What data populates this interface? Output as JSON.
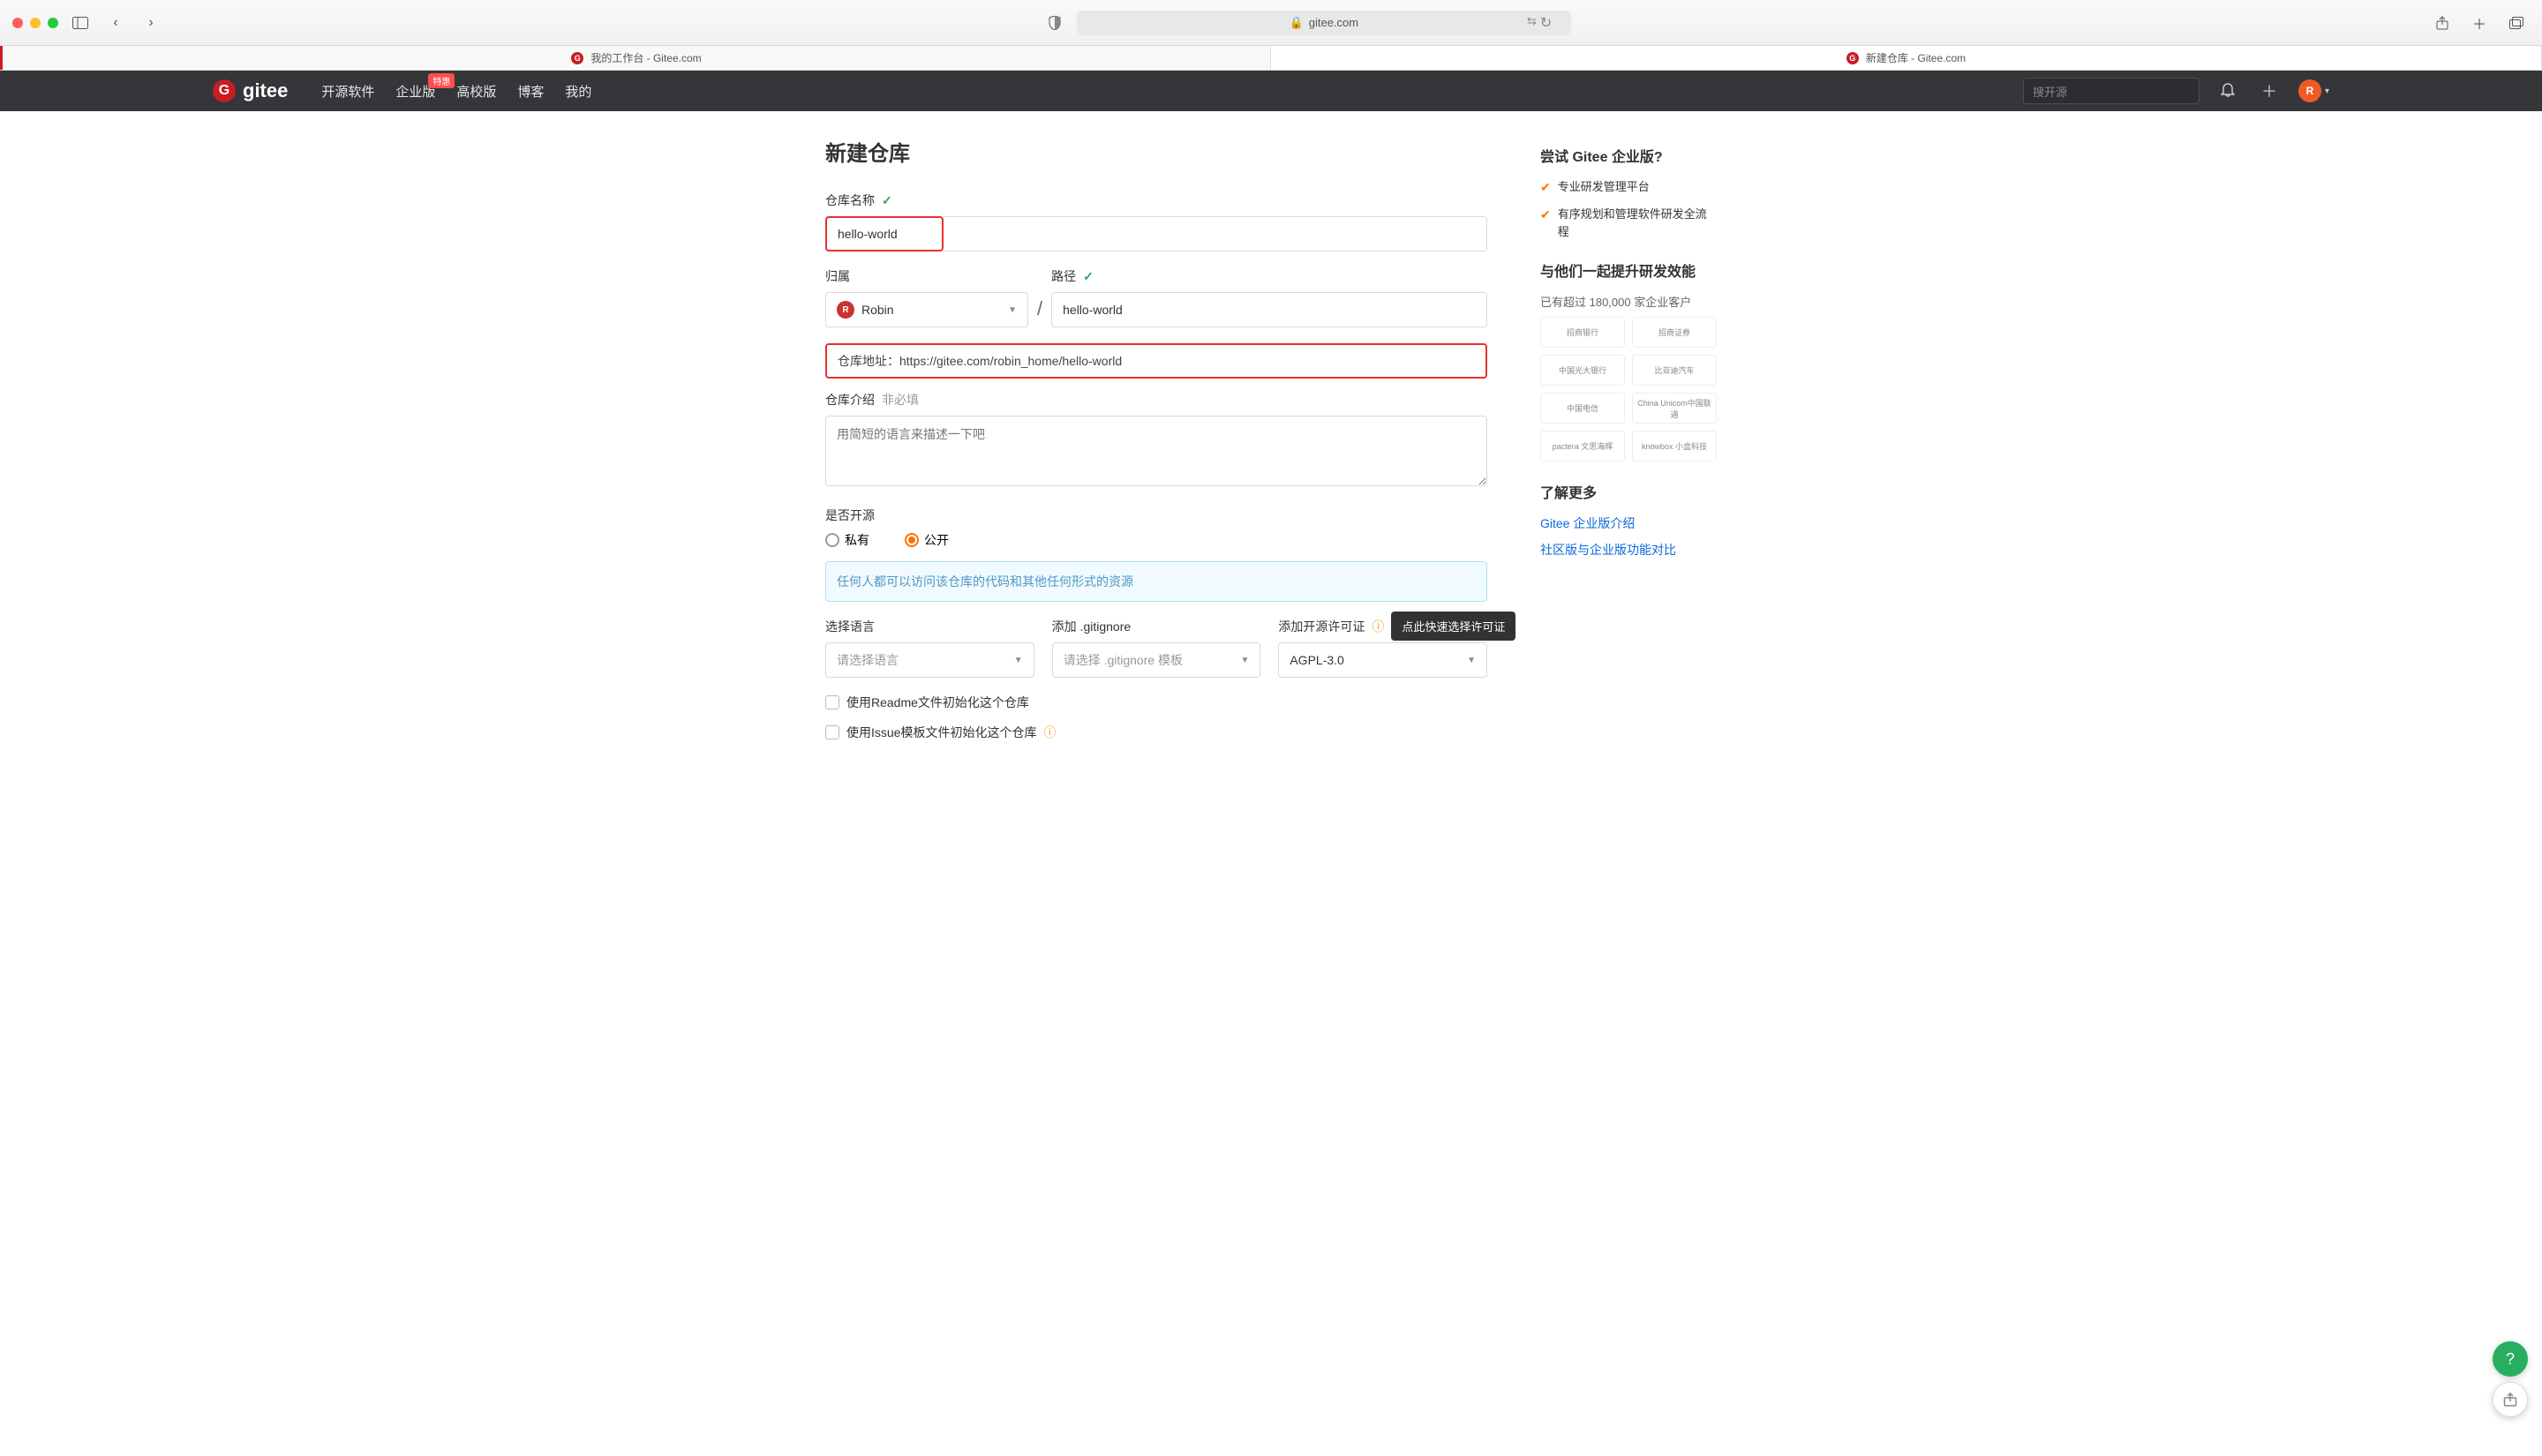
{
  "browser": {
    "url_host": "gitee.com",
    "tabs": [
      {
        "title": "我的工作台 - Gitee.com"
      },
      {
        "title": "新建仓库 - Gitee.com"
      }
    ]
  },
  "header": {
    "logo": "gitee",
    "nav": [
      "开源软件",
      "企业版",
      "高校版",
      "博客",
      "我的"
    ],
    "badge_hot": "特惠",
    "search_placeholder": "搜开源",
    "avatar_letter": "R"
  },
  "page_title": "新建仓库",
  "form": {
    "repo_name": {
      "label": "仓库名称",
      "value": "hello-world"
    },
    "owner": {
      "label": "归属",
      "value": "Robin",
      "avatar_letter": "R"
    },
    "path": {
      "label": "路径",
      "value": "hello-world"
    },
    "url_label": "仓库地址：",
    "url_value": "https://gitee.com/robin_home/hello-world",
    "desc": {
      "label": "仓库介绍",
      "hint": "非必填",
      "placeholder": "用简短的语言来描述一下吧"
    },
    "open_source": {
      "label": "是否开源",
      "private": "私有",
      "public": "公开"
    },
    "public_note": "任何人都可以访问该仓库的代码和其他任何形式的资源",
    "language": {
      "label": "选择语言",
      "placeholder": "请选择语言"
    },
    "gitignore": {
      "label": "添加 .gitignore",
      "placeholder": "请选择 .gitignore 模板"
    },
    "license": {
      "label": "添加开源许可证",
      "value": "AGPL-3.0",
      "tooltip": "点此快速选择许可证"
    },
    "readme": "使用Readme文件初始化这个仓库",
    "issue_tpl": "使用Issue模板文件初始化这个仓库"
  },
  "sidebar": {
    "promo_title": "尝试 Gitee 企业版?",
    "promo_items": [
      "专业研发管理平台",
      "有序规划和管理软件研发全流程"
    ],
    "partners_title": "与他们一起提升研发效能",
    "partners_sub": "已有超过 180,000 家企业客户",
    "partners": [
      "招商银行",
      "招商证券",
      "中国光大银行",
      "比亚迪汽车",
      "中国电信",
      "China Unicom中国联通",
      "pactera 文思海辉",
      "knowbox 小盒科技"
    ],
    "more_title": "了解更多",
    "more_links": [
      "Gitee 企业版介绍",
      "社区版与企业版功能对比"
    ]
  }
}
